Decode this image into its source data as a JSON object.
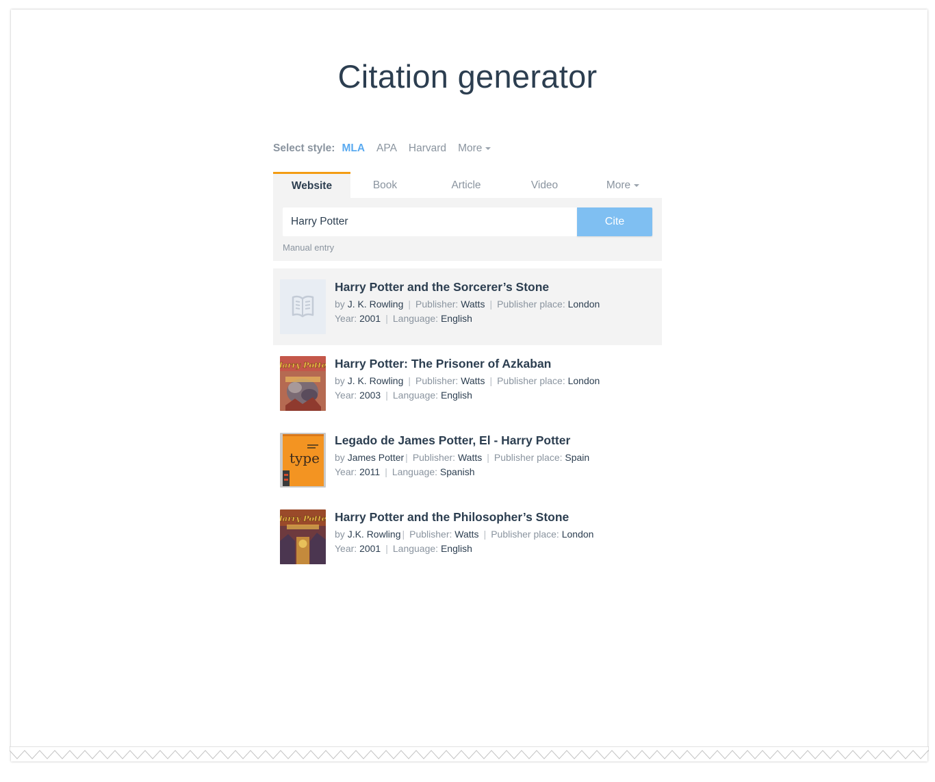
{
  "page": {
    "title": "Citation generator"
  },
  "style_selector": {
    "label": "Select style:",
    "options": [
      "MLA",
      "APA",
      "Harvard",
      "More"
    ],
    "selected": "MLA"
  },
  "source_tabs": {
    "items": [
      "Website",
      "Book",
      "Article",
      "Video",
      "More"
    ],
    "selected": "Website"
  },
  "search": {
    "value": "Harry Potter",
    "cite_label": "Cite",
    "manual_entry_label": "Manual entry"
  },
  "labels": {
    "by": "by",
    "publisher": "Publisher:",
    "publisher_place": "Publisher place:",
    "year": "Year:",
    "language": "Language:",
    "separator": "|"
  },
  "results": [
    {
      "title": "Harry Potter and the Sorcerer’s Stone",
      "author": "J. K. Rowling",
      "publisher": "Watts",
      "publisher_place": "London",
      "year": "2001",
      "language": "English",
      "cover": "placeholder-book-icon"
    },
    {
      "title": "Harry Potter: The Prisoner of Azkaban",
      "author": "J. K. Rowling",
      "publisher": "Watts",
      "publisher_place": "London",
      "year": "2003",
      "language": "English",
      "cover": "harry-potter-cover",
      "cover_text": "Harry Potter"
    },
    {
      "title": "Legado de James Potter, El - Harry Potter",
      "author": "James Potter",
      "publisher": "Watts",
      "publisher_place": "Spain",
      "year": "2011",
      "language": "Spanish",
      "cover": "type-book-cover",
      "cover_text": "type"
    },
    {
      "title": "Harry Potter and the Philosopher’s Stone",
      "author": "J.K. Rowling",
      "publisher": "Watts",
      "publisher_place": "London",
      "year": "2001",
      "language": "English",
      "cover": "harry-potter-cover",
      "cover_text": "Harry Potter"
    }
  ],
  "colors": {
    "title": "#2c3e50",
    "muted": "#8a949f",
    "accent_blue": "#5aaaf0",
    "cite_button": "#7fbff2",
    "active_tab_border": "#f39c12",
    "panel_bg": "#f3f3f3"
  }
}
